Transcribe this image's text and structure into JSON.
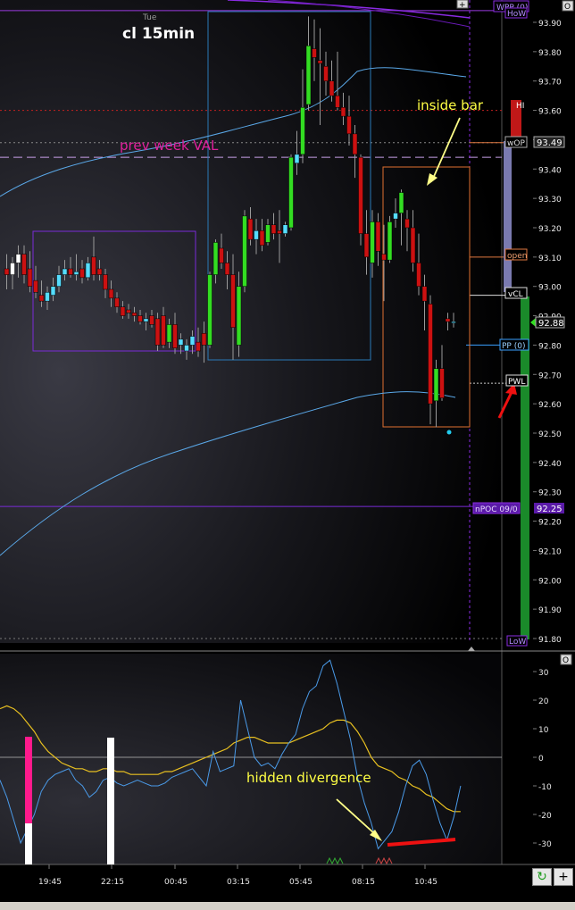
{
  "header": {
    "day": "Tue",
    "title": "cl 15min"
  },
  "price_axis": {
    "labels": [
      "93.90",
      "93.80",
      "93.70",
      "93.60",
      "93.50",
      "93.40",
      "93.30",
      "93.20",
      "93.10",
      "93.00",
      "92.90",
      "92.80",
      "92.70",
      "92.60",
      "92.50",
      "92.40",
      "92.30",
      "92.20",
      "92.10",
      "92.00",
      "91.90",
      "91.80"
    ],
    "current_price": "92.88",
    "wop_price": "93.49",
    "npoc_price": "92.25"
  },
  "osc_axis": {
    "labels": [
      "30",
      "20",
      "10",
      "0",
      "-10",
      "-20",
      "-30"
    ]
  },
  "time_axis": {
    "labels": [
      "19:45",
      "22:15",
      "00:45",
      "03:15",
      "05:45",
      "08:15",
      "10:45"
    ]
  },
  "level_tags": {
    "wpp": "WPP (0)",
    "how": "HoW",
    "hi": "HI",
    "wop": "wOP",
    "open": "open",
    "vcl": "vCL",
    "pp": "PP (0)",
    "pwl": "PWL",
    "npoc": "nPOC 09/0",
    "low": "LoW"
  },
  "annotations": {
    "prev_week_val": "prev week VAL",
    "inside_bar": "inside bar",
    "hidden_divergence": "hidden divergence"
  },
  "controls": {
    "panel_o": "O",
    "axis_o": "O",
    "cross": "+",
    "plus": "+"
  },
  "colors": {
    "bull": "#33dd22",
    "bear": "#cc1111",
    "neutral_bull": "#55ddff",
    "magenta": "#ff1a8c",
    "violet": "#8a2be2"
  },
  "chart_data": {
    "type": "candlestick",
    "title": "cl 15min",
    "ylim": [
      91.78,
      93.96
    ],
    "candles": [
      [
        93.06,
        93.11,
        92.99,
        93.04
      ],
      [
        93.04,
        93.1,
        92.99,
        93.08
      ],
      [
        93.08,
        93.14,
        93.03,
        93.11
      ],
      [
        93.11,
        93.14,
        93.01,
        93.04
      ],
      [
        93.06,
        93.12,
        92.98,
        93.0
      ],
      [
        93.02,
        93.07,
        92.96,
        92.98
      ],
      [
        92.97,
        93.02,
        92.93,
        92.95
      ],
      [
        92.95,
        93.0,
        92.92,
        92.98
      ],
      [
        92.97,
        93.03,
        92.95,
        93.0
      ],
      [
        93.0,
        93.07,
        92.98,
        93.04
      ],
      [
        93.04,
        93.09,
        93.02,
        93.06
      ],
      [
        93.06,
        93.1,
        93.03,
        93.04
      ],
      [
        93.04,
        93.11,
        93.02,
        93.05
      ],
      [
        93.06,
        93.09,
        93.01,
        93.03
      ],
      [
        93.03,
        93.1,
        93.02,
        93.08
      ],
      [
        93.1,
        93.17,
        93.02,
        93.04
      ],
      [
        93.06,
        93.09,
        93.02,
        93.04
      ],
      [
        93.04,
        93.06,
        92.96,
        92.99
      ],
      [
        92.99,
        93.02,
        92.93,
        92.96
      ],
      [
        92.96,
        92.98,
        92.91,
        92.93
      ],
      [
        92.93,
        92.95,
        92.89,
        92.9
      ],
      [
        92.92,
        92.94,
        92.89,
        92.91
      ],
      [
        92.91,
        92.93,
        92.88,
        92.9
      ],
      [
        92.9,
        92.92,
        92.87,
        92.88
      ],
      [
        92.88,
        92.91,
        92.85,
        92.89
      ],
      [
        92.9,
        92.92,
        92.86,
        92.87
      ],
      [
        92.89,
        92.91,
        92.78,
        92.8
      ],
      [
        92.9,
        92.93,
        92.79,
        92.8
      ],
      [
        92.81,
        92.89,
        92.79,
        92.87
      ],
      [
        92.87,
        92.91,
        92.77,
        92.79
      ],
      [
        92.8,
        92.84,
        92.77,
        92.82
      ],
      [
        92.78,
        92.82,
        92.75,
        92.8
      ],
      [
        92.8,
        92.85,
        92.77,
        92.83
      ],
      [
        92.81,
        92.86,
        92.76,
        92.78
      ],
      [
        92.84,
        92.88,
        92.74,
        92.8
      ],
      [
        92.8,
        93.05,
        92.79,
        93.04
      ],
      [
        93.04,
        93.16,
        93.01,
        93.15
      ],
      [
        93.13,
        93.18,
        93.06,
        93.08
      ],
      [
        93.08,
        93.12,
        92.99,
        93.04
      ],
      [
        93.04,
        93.11,
        92.75,
        92.86
      ],
      [
        92.8,
        93.05,
        92.76,
        93.0
      ],
      [
        93.0,
        93.26,
        92.98,
        93.24
      ],
      [
        93.23,
        93.27,
        93.14,
        93.16
      ],
      [
        93.16,
        93.23,
        93.11,
        93.19
      ],
      [
        93.19,
        93.23,
        93.12,
        93.14
      ],
      [
        93.15,
        93.23,
        93.14,
        93.21
      ],
      [
        93.21,
        93.25,
        93.16,
        93.18
      ],
      [
        93.19,
        93.26,
        93.08,
        93.18
      ],
      [
        93.18,
        93.22,
        93.17,
        93.21
      ],
      [
        93.2,
        93.45,
        93.19,
        93.44
      ],
      [
        93.42,
        93.53,
        93.38,
        93.45
      ],
      [
        93.45,
        93.74,
        93.42,
        93.61
      ],
      [
        93.62,
        93.92,
        93.6,
        93.82
      ],
      [
        93.81,
        93.91,
        93.7,
        93.78
      ],
      [
        93.77,
        93.88,
        93.55,
        93.76
      ],
      [
        93.75,
        93.8,
        93.65,
        93.7
      ],
      [
        93.7,
        93.77,
        93.63,
        93.65
      ],
      [
        93.65,
        93.8,
        93.6,
        93.61
      ],
      [
        93.61,
        93.66,
        93.55,
        93.58
      ],
      [
        93.58,
        93.65,
        93.48,
        93.52
      ],
      [
        93.52,
        93.55,
        93.37,
        93.45
      ],
      [
        93.44,
        93.45,
        93.14,
        93.18
      ],
      [
        93.18,
        93.26,
        93.04,
        93.1
      ],
      [
        93.08,
        93.26,
        93.03,
        93.22
      ],
      [
        93.22,
        93.25,
        93.07,
        93.12
      ],
      [
        93.11,
        93.21,
        92.95,
        93.09
      ],
      [
        93.09,
        93.24,
        93.08,
        93.22
      ],
      [
        93.23,
        93.3,
        93.2,
        93.25
      ],
      [
        93.25,
        93.33,
        93.14,
        93.32
      ],
      [
        93.23,
        93.26,
        93.12,
        93.2
      ],
      [
        93.2,
        93.26,
        93.05,
        93.08
      ],
      [
        93.08,
        93.18,
        92.97,
        93.0
      ],
      [
        93.0,
        93.04,
        92.85,
        92.95
      ],
      [
        92.94,
        92.97,
        92.53,
        92.6
      ],
      [
        92.61,
        92.75,
        92.52,
        92.72
      ],
      [
        92.72,
        92.8,
        92.61,
        92.62
      ],
      [
        92.89,
        92.91,
        92.85,
        92.88
      ],
      [
        92.88,
        92.91,
        92.86,
        92.88
      ]
    ],
    "levels": [
      {
        "label": "WPP (0)",
        "value": 93.94
      },
      {
        "label": "HoW",
        "value": 93.92
      },
      {
        "label": "HI",
        "value": 93.6
      },
      {
        "label": "wOP",
        "value": 93.49
      },
      {
        "label": "prev week VAL",
        "value": 93.44
      },
      {
        "label": "open",
        "value": 93.1
      },
      {
        "label": "vCL",
        "value": 92.97
      },
      {
        "label": "PP (0)",
        "value": 92.8
      },
      {
        "label": "PWL",
        "value": 92.67
      },
      {
        "label": "nPOC 09/0",
        "value": 92.25
      },
      {
        "label": "LoW",
        "value": 91.8
      }
    ],
    "oscillator": {
      "ylim": [
        -38,
        36
      ],
      "fast": [
        -8,
        -14,
        -22,
        -30,
        -25,
        -20,
        -12,
        -8,
        -6,
        -5,
        -4,
        -8,
        -10,
        -14,
        -12,
        -8,
        -7,
        -9,
        -10,
        -9,
        -8,
        -9,
        -10,
        -10,
        -9,
        -7,
        -6,
        -5,
        -4,
        -7,
        -10,
        2,
        -5,
        -4,
        -3,
        20,
        10,
        0,
        -3,
        -2,
        -4,
        1,
        5,
        8,
        17,
        23,
        25,
        32,
        34,
        26,
        16,
        6,
        -7,
        -16,
        -23,
        -32,
        -29,
        -26,
        -19,
        -10,
        -3,
        -1,
        -6,
        -15,
        -23,
        -29,
        -21,
        -10
      ],
      "slow": [
        17,
        18,
        17,
        15,
        12,
        9,
        5,
        2,
        0,
        -2,
        -3,
        -4,
        -4,
        -5,
        -5,
        -4,
        -4,
        -5,
        -5,
        -6,
        -6,
        -6,
        -6,
        -6,
        -5,
        -5,
        -4,
        -3,
        -2,
        -1,
        0,
        1,
        2,
        3,
        5,
        6,
        7,
        7,
        6,
        5,
        5,
        5,
        5,
        6,
        7,
        8,
        9,
        10,
        12,
        13,
        13,
        12,
        9,
        5,
        0,
        -3,
        -4,
        -5,
        -7,
        -8,
        -10,
        -11,
        -13,
        -14,
        -16,
        -18,
        -19,
        -19
      ],
      "histogram": [
        {
          "bar": "magenta-white",
          "x_label": "19:45"
        },
        {
          "bar": "white",
          "x_label": "22:15"
        }
      ],
      "divergence_line": [
        -31,
        -29
      ]
    }
  }
}
